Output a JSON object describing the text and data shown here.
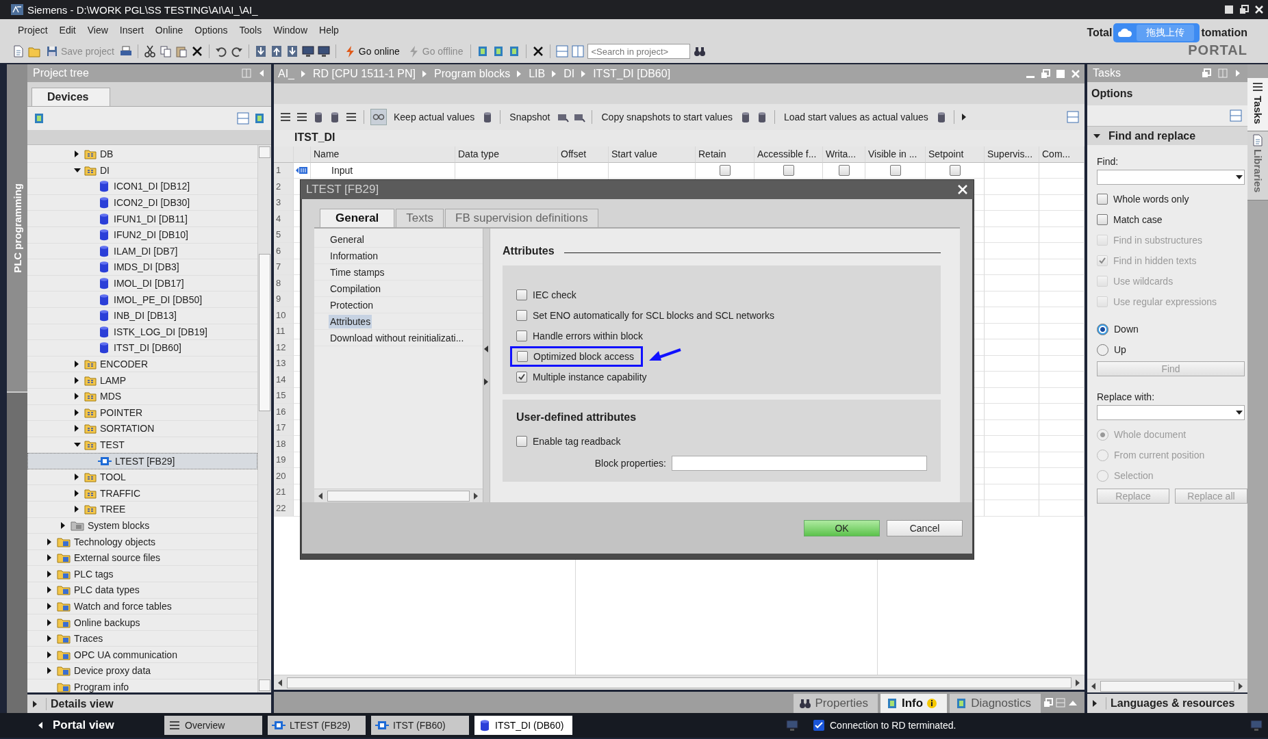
{
  "window": {
    "title": "Siemens - D:\\WORK PGL\\SS TESTING\\AI\\AI_\\AI_"
  },
  "menu": [
    "Project",
    "Edit",
    "View",
    "Insert",
    "Online",
    "Options",
    "Tools",
    "Window",
    "Help"
  ],
  "toolbar": {
    "items": [
      {
        "label": "Save project",
        "disabled": true
      },
      {
        "label": "Go online",
        "disabled": false
      },
      {
        "label": "Go offline",
        "disabled": true
      }
    ],
    "search": {
      "placeholder": "<Search in project>"
    }
  },
  "branding": {
    "text_1": "Total",
    "text_2": "tomation",
    "text_3": "PORTAL"
  },
  "upload_badge": {
    "label": "拖拽上传"
  },
  "side_strip": {
    "label": "PLC programming"
  },
  "project_tree": {
    "title": "Project tree",
    "tab": "Devices",
    "items": [
      {
        "children": [
          {
            "children": [
              {
                "label": "DB",
                "kind": "folder",
                "expanded": false,
                "selected": false
              },
              {
                "label": "DI",
                "kind": "folder",
                "expanded": true,
                "selected": false,
                "children": [
                  {
                    "label": "ICON1_DI [DB12]",
                    "kind": "db",
                    "selected": false
                  },
                  {
                    "label": "ICON2_DI [DB30]",
                    "kind": "db",
                    "selected": false
                  },
                  {
                    "label": "IFUN1_DI [DB11]",
                    "kind": "db",
                    "selected": false
                  },
                  {
                    "label": "IFUN2_DI [DB10]",
                    "kind": "db",
                    "selected": false
                  },
                  {
                    "label": "ILAM_DI [DB7]",
                    "kind": "db",
                    "selected": false
                  },
                  {
                    "label": "IMDS_DI [DB3]",
                    "kind": "db",
                    "selected": false
                  },
                  {
                    "label": "IMOL_DI [DB17]",
                    "kind": "db",
                    "selected": false
                  },
                  {
                    "label": "IMOL_PE_DI [DB50]",
                    "kind": "db",
                    "selected": false
                  },
                  {
                    "label": "INB_DI [DB13]",
                    "kind": "db",
                    "selected": false
                  },
                  {
                    "label": "ISTK_LOG_DI [DB19]",
                    "kind": "db",
                    "selected": false
                  },
                  {
                    "label": "ITST_DI [DB60]",
                    "kind": "db",
                    "selected": false
                  }
                ]
              },
              {
                "label": "ENCODER",
                "kind": "folder",
                "expanded": false,
                "selected": false
              },
              {
                "label": "LAMP",
                "kind": "folder",
                "expanded": false,
                "selected": false
              },
              {
                "label": "MDS",
                "kind": "folder",
                "expanded": false,
                "selected": false
              },
              {
                "label": "POINTER",
                "kind": "folder",
                "expanded": false,
                "selected": false
              },
              {
                "label": "SORTATION",
                "kind": "folder",
                "expanded": false,
                "selected": false
              },
              {
                "label": "TEST",
                "kind": "folder",
                "expanded": true,
                "selected": false,
                "children": [
                  {
                    "label": "LTEST [FB29]",
                    "kind": "fb",
                    "selected": true
                  }
                ]
              },
              {
                "label": "TOOL",
                "kind": "folder",
                "expanded": false,
                "selected": false
              },
              {
                "label": "TRAFFIC",
                "kind": "folder",
                "expanded": false,
                "selected": false
              },
              {
                "label": "TREE",
                "kind": "folder",
                "expanded": false,
                "selected": false
              }
            ]
          },
          {
            "label": "System blocks",
            "kind": "system",
            "expanded": false,
            "selected": false
          }
        ]
      },
      {
        "label": "Technology objects",
        "kind": "special",
        "expanded": false,
        "selected": false
      },
      {
        "label": "External source files",
        "kind": "special",
        "expanded": false,
        "selected": false
      },
      {
        "label": "PLC tags",
        "kind": "special",
        "expanded": false,
        "selected": false
      },
      {
        "label": "PLC data types",
        "kind": "special",
        "expanded": false,
        "selected": false
      },
      {
        "label": "Watch and force tables",
        "kind": "special",
        "expanded": false,
        "selected": false
      },
      {
        "label": "Online backups",
        "kind": "special",
        "expanded": false,
        "selected": false
      },
      {
        "label": "Traces",
        "kind": "special",
        "expanded": false,
        "selected": false
      },
      {
        "label": "OPC UA communication",
        "kind": "special",
        "expanded": false,
        "selected": false
      },
      {
        "label": "Device proxy data",
        "kind": "special",
        "expanded": false,
        "selected": false
      },
      {
        "label": "Program info",
        "kind": "special",
        "selected": false
      }
    ]
  },
  "details_view": {
    "label": "Details view"
  },
  "editor": {
    "breadcrumb": [
      "AI_",
      "RD [CPU 1511-1 PN]",
      "Program blocks",
      "LIB",
      "DI",
      "ITST_DI [DB60]"
    ],
    "toolbar": [
      "Keep actual values",
      "Snapshot",
      "Copy snapshots to start values",
      "Load start values as actual values"
    ],
    "block_title": "ITST_DI",
    "table": {
      "columns": [
        "Name",
        "Data type",
        "Offset",
        "Start value",
        "Retain",
        "Accessible f...",
        "Writa...",
        "Visible in ...",
        "Setpoint",
        "Supervis...",
        "Com..."
      ],
      "rows": [
        {
          "number": "1",
          "name": "Input",
          "checkboxes": [
            {
              "checked": false
            },
            {
              "checked": false
            },
            {
              "checked": false
            },
            {
              "checked": false
            },
            {
              "checked": false
            }
          ]
        },
        {
          "number": "2"
        },
        {
          "number": "3"
        },
        {
          "number": "4"
        },
        {
          "number": "5"
        },
        {
          "number": "6"
        },
        {
          "number": "7"
        },
        {
          "number": "8"
        },
        {
          "number": "9"
        },
        {
          "number": "10"
        },
        {
          "number": "11"
        },
        {
          "number": "12"
        },
        {
          "number": "13"
        },
        {
          "number": "14"
        },
        {
          "number": "15"
        },
        {
          "number": "16"
        },
        {
          "number": "17"
        },
        {
          "number": "18"
        },
        {
          "number": "19"
        },
        {
          "number": "20"
        },
        {
          "number": "21"
        },
        {
          "number": "22"
        }
      ]
    }
  },
  "dialog": {
    "title": "LTEST [FB29]",
    "tabs": [
      {
        "label": "General",
        "selected": true
      },
      {
        "label": "Texts",
        "selected": false
      },
      {
        "label": "FB supervision definitions",
        "selected": false
      }
    ],
    "nav": [
      {
        "label": "General",
        "selected": false
      },
      {
        "label": "Information",
        "selected": false
      },
      {
        "label": "Time stamps",
        "selected": false
      },
      {
        "label": "Compilation",
        "selected": false
      },
      {
        "label": "Protection",
        "selected": false
      },
      {
        "label": "Attributes",
        "selected": true
      },
      {
        "label": "Download without reinitializati...",
        "selected": false
      }
    ],
    "section_title": "Attributes",
    "attributes": [
      {
        "label": "IEC check",
        "checked": false,
        "highlighted": false
      },
      {
        "label": "Set ENO automatically for SCL blocks and SCL networks",
        "checked": false,
        "highlighted": false
      },
      {
        "label": "Handle errors within block",
        "checked": false,
        "highlighted": false
      },
      {
        "label": "Optimized block access",
        "checked": false,
        "highlighted": true
      },
      {
        "label": "Multiple instance capability",
        "checked": true,
        "highlighted": false
      }
    ],
    "user_section_title": "User-defined attributes",
    "user_attributes": [
      {
        "label": "Enable tag readback",
        "checked": false
      }
    ],
    "block_properties": {
      "label": "Block properties:"
    },
    "buttons": [
      {
        "label": "OK",
        "primary": true
      },
      {
        "label": "Cancel",
        "primary": false
      }
    ]
  },
  "tasks": {
    "title": "Tasks",
    "options": "Options",
    "section": "Find and replace",
    "find_label": "Find:",
    "find_options": [
      {
        "label": "Whole words only",
        "checked": false,
        "disabled": false
      },
      {
        "label": "Match case",
        "checked": false,
        "disabled": false
      },
      {
        "label": "Find in substructures",
        "checked": false,
        "disabled": true
      },
      {
        "label": "Find in hidden texts",
        "checked": true,
        "disabled": true
      },
      {
        "label": "Use wildcards",
        "checked": false,
        "disabled": true
      },
      {
        "label": "Use regular expressions",
        "checked": false,
        "disabled": true
      }
    ],
    "direction": [
      {
        "label": "Down",
        "selected": true,
        "disabled": false
      },
      {
        "label": "Up",
        "selected": false,
        "disabled": false
      }
    ],
    "find_button": "Find",
    "replace_label": "Replace with:",
    "scope": [
      {
        "label": "Whole document",
        "selected": true,
        "disabled": true
      },
      {
        "label": "From current position",
        "selected": false,
        "disabled": true
      },
      {
        "label": "Selection",
        "selected": false,
        "disabled": true
      }
    ],
    "replace_buttons": [
      "Replace",
      "Replace all"
    ],
    "bottom_section": "Languages & resources",
    "side_tabs": [
      {
        "label": "Tasks",
        "selected": true
      },
      {
        "label": "Libraries",
        "selected": false
      }
    ]
  },
  "inspector_tabs": [
    {
      "label": "Properties",
      "selected": false
    },
    {
      "label": "Info",
      "selected": true
    },
    {
      "label": "Diagnostics",
      "selected": false
    }
  ],
  "portal_bar": {
    "portal_view": "Portal view",
    "tabs": [
      {
        "label": "Overview",
        "kind": "overview",
        "selected": false
      },
      {
        "label": "LTEST (FB29)",
        "kind": "fb",
        "selected": false
      },
      {
        "label": "ITST (FB60)",
        "kind": "fb",
        "selected": false
      },
      {
        "label": "ITST_DI (DB60)",
        "kind": "db",
        "selected": true
      }
    ],
    "status": "Connection to RD terminated."
  }
}
